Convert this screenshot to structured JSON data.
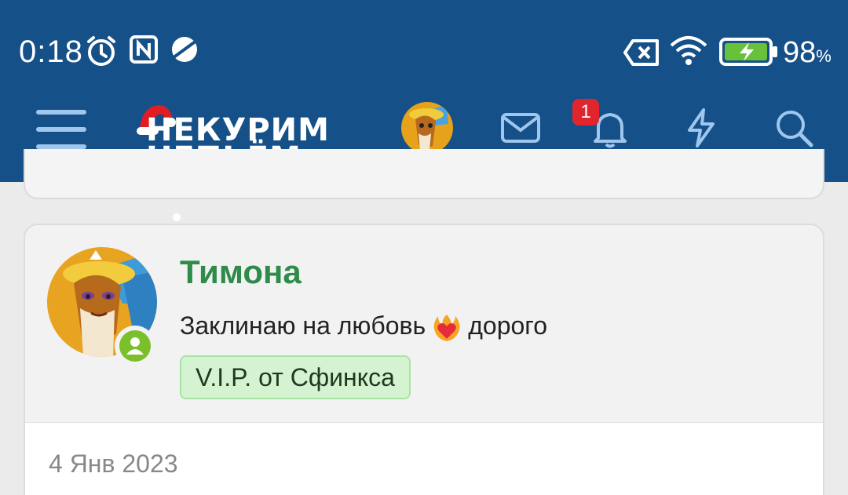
{
  "status_bar": {
    "time": "0:18",
    "battery_percent": "98",
    "battery_unit": "%",
    "icons": [
      "alarm-icon",
      "nfc-icon",
      "planet-icon",
      "no-sim-icon",
      "wifi-icon",
      "battery-charging-icon"
    ]
  },
  "nav": {
    "logo_line1": "НЕКУРИМ",
    "logo_line2": "НЕПЬЁМ",
    "notification_count": "1",
    "colors": {
      "bar": "#155088",
      "icon": "#9fc6ec",
      "badge": "#e0252d"
    }
  },
  "post": {
    "username": "Тимона",
    "status_before": "Заклинаю на любовь",
    "status_after": "дорого",
    "status_emoji": "heart-on-fire",
    "badge": "V.I.P. от Сфинкса",
    "date": "4 Янв 2023",
    "colors": {
      "username": "#2e8b49",
      "online": "#7bbf2a",
      "badge_bg": "#d4f4d1"
    }
  }
}
